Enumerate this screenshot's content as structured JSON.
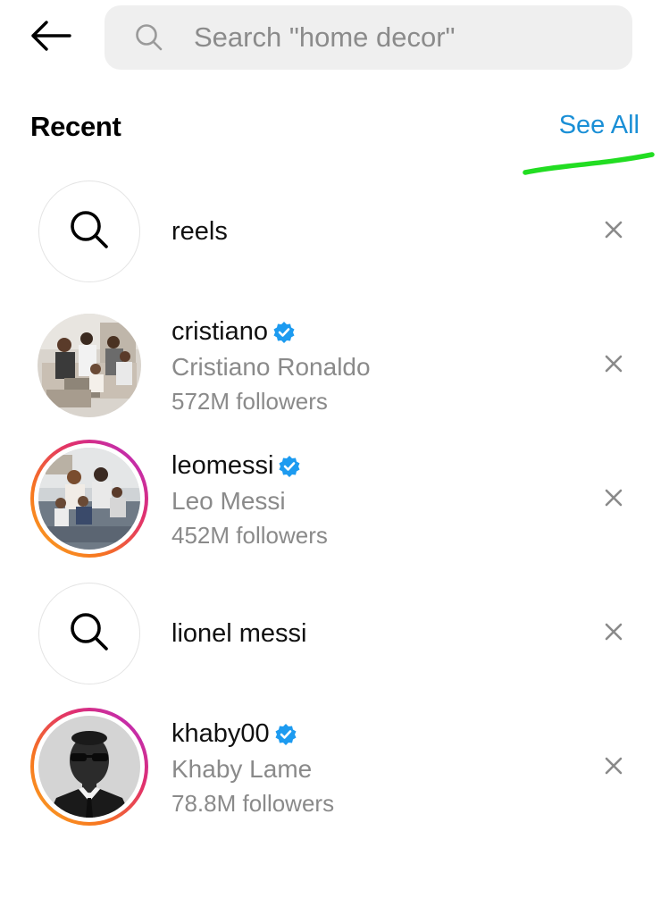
{
  "header": {
    "back_icon": "arrow-left-icon",
    "search": {
      "placeholder": "Search \"home decor\"",
      "icon": "search-icon"
    }
  },
  "recent": {
    "title": "Recent",
    "see_all_label": "See All",
    "annotation_color": "#22dd22",
    "items": [
      {
        "type": "query",
        "label": "reels",
        "icon": "search-icon"
      },
      {
        "type": "account",
        "username": "cristiano",
        "verified": true,
        "full_name": "Cristiano Ronaldo",
        "followers": "572M followers",
        "has_story": false
      },
      {
        "type": "account",
        "username": "leomessi",
        "verified": true,
        "full_name": "Leo Messi",
        "followers": "452M followers",
        "has_story": true
      },
      {
        "type": "query",
        "label": "lionel messi",
        "icon": "search-icon"
      },
      {
        "type": "account",
        "username": "khaby00",
        "verified": true,
        "full_name": "Khaby Lame",
        "followers": "78.8M followers",
        "has_story": true
      }
    ]
  },
  "colors": {
    "accent_link": "#1a8fd6",
    "verified_badge": "#1d9bf0",
    "secondary_text": "#8a8a8a",
    "search_bg": "#efefef"
  }
}
